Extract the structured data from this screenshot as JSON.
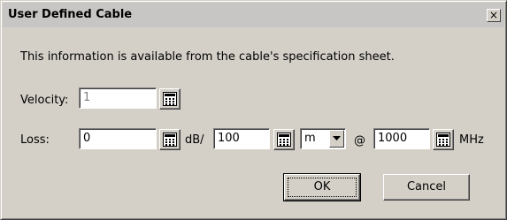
{
  "dialog": {
    "title": "User Defined Cable",
    "close_label": "×",
    "info_text": "This information is available from the cable's specification sheet."
  },
  "velocity": {
    "label": "Velocity:",
    "value": "1"
  },
  "loss": {
    "label": "Loss:",
    "value": "0",
    "unit_db": "dB/",
    "length_value": "100",
    "length_unit": "m",
    "at_label": "@",
    "freq_value": "1000",
    "freq_unit": "MHz"
  },
  "buttons": {
    "ok": "OK",
    "cancel": "Cancel"
  },
  "icons": {
    "calculator": "calculator-icon",
    "dropdown": "chevron-down-icon",
    "close": "close-icon"
  }
}
